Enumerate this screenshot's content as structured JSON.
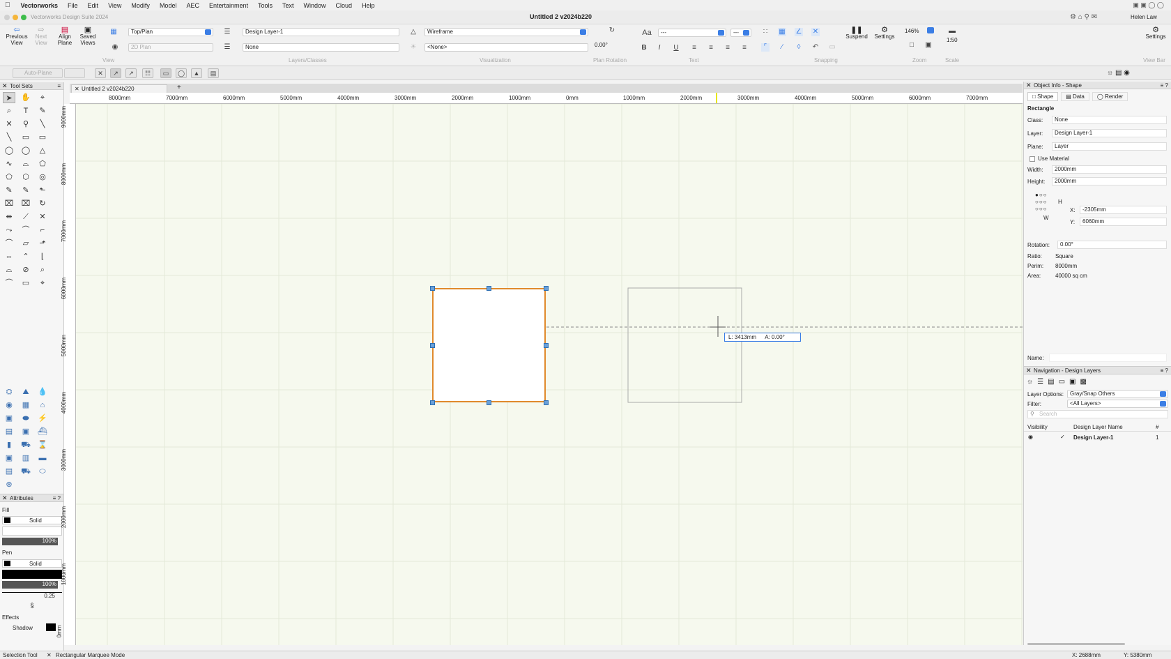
{
  "menubar": {
    "app_name": "Vectorworks",
    "items": [
      "File",
      "Edit",
      "View",
      "Modify",
      "Model",
      "AEC",
      "Entertainment",
      "Tools",
      "Text",
      "Window",
      "Cloud",
      "Help"
    ]
  },
  "titlebar": {
    "app_title": "Vectorworks Design Suite 2024",
    "doc_title": "Untitled 2 v2024b220",
    "user": "Helen Law"
  },
  "toolbar": {
    "previous_view": "Previous View",
    "next_view": "Next View",
    "align_plane": "Align Plane",
    "saved_views": "Saved Views",
    "view_dropdown": "Top/Plan",
    "plane_dropdown": "2D Plan",
    "layer_dropdown": "Design Layer-1",
    "class_dropdown": "None",
    "render_dropdown": "Wireframe",
    "light_dropdown": "<None>",
    "rotation_value": "0.00°",
    "font_dropdown": "---",
    "size_dropdown": "---",
    "suspend": "Suspend",
    "settings": "Settings",
    "zoom_value": "146%",
    "scale_value": "1:50",
    "settings_right": "Settings",
    "group_view": "View",
    "group_layers": "Layers/Classes",
    "group_visualization": "Visualization",
    "group_plan_rotation": "Plan Rotation",
    "group_text": "Text",
    "group_snapping": "Snapping",
    "group_zoom": "Zoom",
    "group_scale": "Scale",
    "group_viewbar": "View Bar",
    "auto_plane": "Auto-Plane"
  },
  "toolsets": {
    "title": "Tool Sets"
  },
  "attributes": {
    "title": "Attributes",
    "fill_label": "Fill",
    "fill_style": "Solid",
    "fill_opacity": "100%",
    "pen_label": "Pen",
    "pen_style": "Solid",
    "pen_opacity": "100%",
    "pen_weight": "0.25",
    "effects_label": "Effects",
    "shadow_label": "Shadow"
  },
  "document": {
    "tab_label": "Untitled 2 v2024b220",
    "add_tab": "+"
  },
  "ruler": {
    "top_labels": [
      "8000mm",
      "7000mm",
      "6000mm",
      "5000mm",
      "4000mm",
      "3000mm",
      "2000mm",
      "1000mm",
      "0mm",
      "1000mm",
      "2000mm",
      "3000mm",
      "4000mm",
      "5000mm",
      "6000mm",
      "7000mm"
    ],
    "left_labels": [
      "9000mm",
      "8000mm",
      "7000mm",
      "6000mm",
      "5000mm",
      "4000mm",
      "3000mm",
      "2000mm",
      "1000mm",
      "0mm"
    ]
  },
  "canvas": {
    "tooltip_length": "L:  3413mm",
    "tooltip_angle": "A:  0.00°"
  },
  "object_info": {
    "title": "Object Info - Shape",
    "tab_shape": "Shape",
    "tab_data": "Data",
    "tab_render": "Render",
    "object_type": "Rectangle",
    "class_label": "Class:",
    "class_value": "None",
    "layer_label": "Layer:",
    "layer_value": "Design Layer-1",
    "plane_label": "Plane:",
    "plane_value": "Layer",
    "use_material": "Use Material",
    "width_label": "Width:",
    "width_value": "2000mm",
    "height_label": "Height:",
    "height_value": "2000mm",
    "h_label": "H",
    "w_label": "W",
    "x_label": "X:",
    "x_value": "-2305mm",
    "y_label": "Y:",
    "y_value": "6060mm",
    "rotation_label": "Rotation:",
    "rotation_value": "0.00°",
    "ratio_label": "Ratio:",
    "ratio_value": "Square",
    "perim_label": "Perim:",
    "perim_value": "8000mm",
    "area_label": "Area:",
    "area_value": "40000 sq cm",
    "name_label": "Name:"
  },
  "navigation": {
    "title": "Navigation - Design Layers",
    "layer_options_label": "Layer Options:",
    "layer_options_value": "Gray/Snap Others",
    "filter_label": "Filter:",
    "filter_value": "<All Layers>",
    "search_placeholder": "Search",
    "col_visibility": "Visibility",
    "col_name": "Design Layer Name",
    "col_num": "#",
    "rows": [
      {
        "name": "Design Layer-1",
        "num": "1"
      }
    ]
  },
  "status": {
    "tool": "Selection Tool",
    "mode": "Rectangular Marquee Mode",
    "x_coord": "X: 2688mm",
    "y_coord": "Y: 5380mm"
  }
}
